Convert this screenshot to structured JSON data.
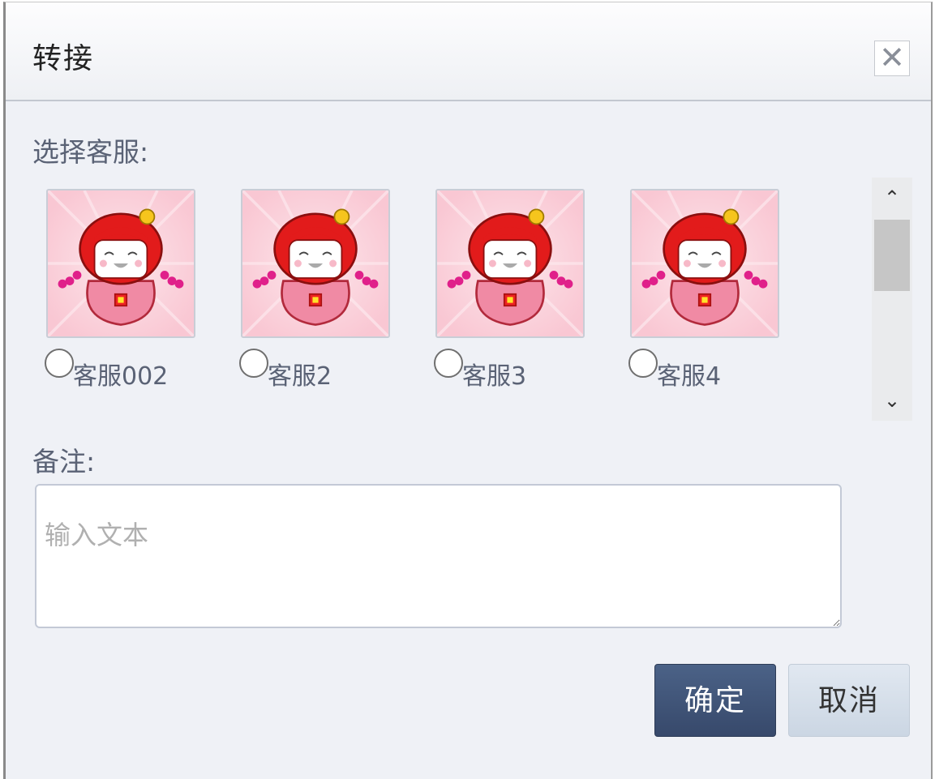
{
  "dialog": {
    "title": "转接",
    "close_symbol": "✕",
    "close_icon": "close-icon"
  },
  "select_agent": {
    "label": "选择客服:",
    "agents": [
      {
        "name": "客服002",
        "avatar_icon": "girl-avatar-icon",
        "selected": false
      },
      {
        "name": "客服2",
        "avatar_icon": "girl-avatar-icon",
        "selected": false
      },
      {
        "name": "客服3",
        "avatar_icon": "girl-avatar-icon",
        "selected": false
      },
      {
        "name": "客服4",
        "avatar_icon": "girl-avatar-icon",
        "selected": false
      }
    ],
    "scroll_up_symbol": "⌃",
    "scroll_down_symbol": "⌄"
  },
  "note": {
    "label": "备注:",
    "value": "",
    "placeholder": "输入文本"
  },
  "buttons": {
    "confirm_label": "确定",
    "cancel_label": "取消"
  },
  "colors": {
    "primary_button": "#3f5479",
    "secondary_button": "#d4dde8",
    "dialog_background": "#eff1f6",
    "avatar_background": "#fbd3dc"
  }
}
